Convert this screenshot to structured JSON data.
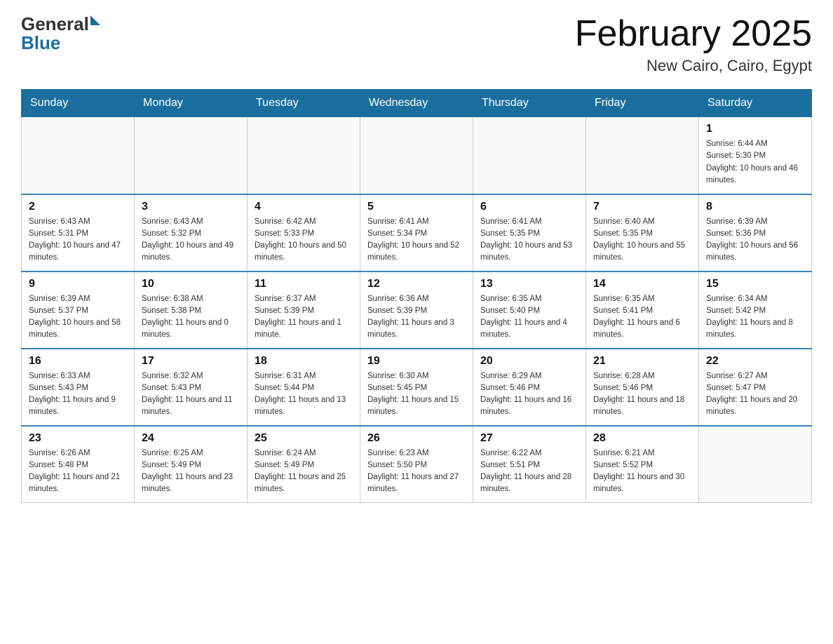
{
  "header": {
    "logo_general": "General",
    "logo_blue": "Blue",
    "title": "February 2025",
    "subtitle": "New Cairo, Cairo, Egypt"
  },
  "weekdays": [
    "Sunday",
    "Monday",
    "Tuesday",
    "Wednesday",
    "Thursday",
    "Friday",
    "Saturday"
  ],
  "weeks": [
    [
      {
        "day": "",
        "sunrise": "",
        "sunset": "",
        "daylight": ""
      },
      {
        "day": "",
        "sunrise": "",
        "sunset": "",
        "daylight": ""
      },
      {
        "day": "",
        "sunrise": "",
        "sunset": "",
        "daylight": ""
      },
      {
        "day": "",
        "sunrise": "",
        "sunset": "",
        "daylight": ""
      },
      {
        "day": "",
        "sunrise": "",
        "sunset": "",
        "daylight": ""
      },
      {
        "day": "",
        "sunrise": "",
        "sunset": "",
        "daylight": ""
      },
      {
        "day": "1",
        "sunrise": "Sunrise: 6:44 AM",
        "sunset": "Sunset: 5:30 PM",
        "daylight": "Daylight: 10 hours and 46 minutes."
      }
    ],
    [
      {
        "day": "2",
        "sunrise": "Sunrise: 6:43 AM",
        "sunset": "Sunset: 5:31 PM",
        "daylight": "Daylight: 10 hours and 47 minutes."
      },
      {
        "day": "3",
        "sunrise": "Sunrise: 6:43 AM",
        "sunset": "Sunset: 5:32 PM",
        "daylight": "Daylight: 10 hours and 49 minutes."
      },
      {
        "day": "4",
        "sunrise": "Sunrise: 6:42 AM",
        "sunset": "Sunset: 5:33 PM",
        "daylight": "Daylight: 10 hours and 50 minutes."
      },
      {
        "day": "5",
        "sunrise": "Sunrise: 6:41 AM",
        "sunset": "Sunset: 5:34 PM",
        "daylight": "Daylight: 10 hours and 52 minutes."
      },
      {
        "day": "6",
        "sunrise": "Sunrise: 6:41 AM",
        "sunset": "Sunset: 5:35 PM",
        "daylight": "Daylight: 10 hours and 53 minutes."
      },
      {
        "day": "7",
        "sunrise": "Sunrise: 6:40 AM",
        "sunset": "Sunset: 5:35 PM",
        "daylight": "Daylight: 10 hours and 55 minutes."
      },
      {
        "day": "8",
        "sunrise": "Sunrise: 6:39 AM",
        "sunset": "Sunset: 5:36 PM",
        "daylight": "Daylight: 10 hours and 56 minutes."
      }
    ],
    [
      {
        "day": "9",
        "sunrise": "Sunrise: 6:39 AM",
        "sunset": "Sunset: 5:37 PM",
        "daylight": "Daylight: 10 hours and 58 minutes."
      },
      {
        "day": "10",
        "sunrise": "Sunrise: 6:38 AM",
        "sunset": "Sunset: 5:38 PM",
        "daylight": "Daylight: 11 hours and 0 minutes."
      },
      {
        "day": "11",
        "sunrise": "Sunrise: 6:37 AM",
        "sunset": "Sunset: 5:39 PM",
        "daylight": "Daylight: 11 hours and 1 minute."
      },
      {
        "day": "12",
        "sunrise": "Sunrise: 6:36 AM",
        "sunset": "Sunset: 5:39 PM",
        "daylight": "Daylight: 11 hours and 3 minutes."
      },
      {
        "day": "13",
        "sunrise": "Sunrise: 6:35 AM",
        "sunset": "Sunset: 5:40 PM",
        "daylight": "Daylight: 11 hours and 4 minutes."
      },
      {
        "day": "14",
        "sunrise": "Sunrise: 6:35 AM",
        "sunset": "Sunset: 5:41 PM",
        "daylight": "Daylight: 11 hours and 6 minutes."
      },
      {
        "day": "15",
        "sunrise": "Sunrise: 6:34 AM",
        "sunset": "Sunset: 5:42 PM",
        "daylight": "Daylight: 11 hours and 8 minutes."
      }
    ],
    [
      {
        "day": "16",
        "sunrise": "Sunrise: 6:33 AM",
        "sunset": "Sunset: 5:43 PM",
        "daylight": "Daylight: 11 hours and 9 minutes."
      },
      {
        "day": "17",
        "sunrise": "Sunrise: 6:32 AM",
        "sunset": "Sunset: 5:43 PM",
        "daylight": "Daylight: 11 hours and 11 minutes."
      },
      {
        "day": "18",
        "sunrise": "Sunrise: 6:31 AM",
        "sunset": "Sunset: 5:44 PM",
        "daylight": "Daylight: 11 hours and 13 minutes."
      },
      {
        "day": "19",
        "sunrise": "Sunrise: 6:30 AM",
        "sunset": "Sunset: 5:45 PM",
        "daylight": "Daylight: 11 hours and 15 minutes."
      },
      {
        "day": "20",
        "sunrise": "Sunrise: 6:29 AM",
        "sunset": "Sunset: 5:46 PM",
        "daylight": "Daylight: 11 hours and 16 minutes."
      },
      {
        "day": "21",
        "sunrise": "Sunrise: 6:28 AM",
        "sunset": "Sunset: 5:46 PM",
        "daylight": "Daylight: 11 hours and 18 minutes."
      },
      {
        "day": "22",
        "sunrise": "Sunrise: 6:27 AM",
        "sunset": "Sunset: 5:47 PM",
        "daylight": "Daylight: 11 hours and 20 minutes."
      }
    ],
    [
      {
        "day": "23",
        "sunrise": "Sunrise: 6:26 AM",
        "sunset": "Sunset: 5:48 PM",
        "daylight": "Daylight: 11 hours and 21 minutes."
      },
      {
        "day": "24",
        "sunrise": "Sunrise: 6:25 AM",
        "sunset": "Sunset: 5:49 PM",
        "daylight": "Daylight: 11 hours and 23 minutes."
      },
      {
        "day": "25",
        "sunrise": "Sunrise: 6:24 AM",
        "sunset": "Sunset: 5:49 PM",
        "daylight": "Daylight: 11 hours and 25 minutes."
      },
      {
        "day": "26",
        "sunrise": "Sunrise: 6:23 AM",
        "sunset": "Sunset: 5:50 PM",
        "daylight": "Daylight: 11 hours and 27 minutes."
      },
      {
        "day": "27",
        "sunrise": "Sunrise: 6:22 AM",
        "sunset": "Sunset: 5:51 PM",
        "daylight": "Daylight: 11 hours and 28 minutes."
      },
      {
        "day": "28",
        "sunrise": "Sunrise: 6:21 AM",
        "sunset": "Sunset: 5:52 PM",
        "daylight": "Daylight: 11 hours and 30 minutes."
      },
      {
        "day": "",
        "sunrise": "",
        "sunset": "",
        "daylight": ""
      }
    ]
  ]
}
